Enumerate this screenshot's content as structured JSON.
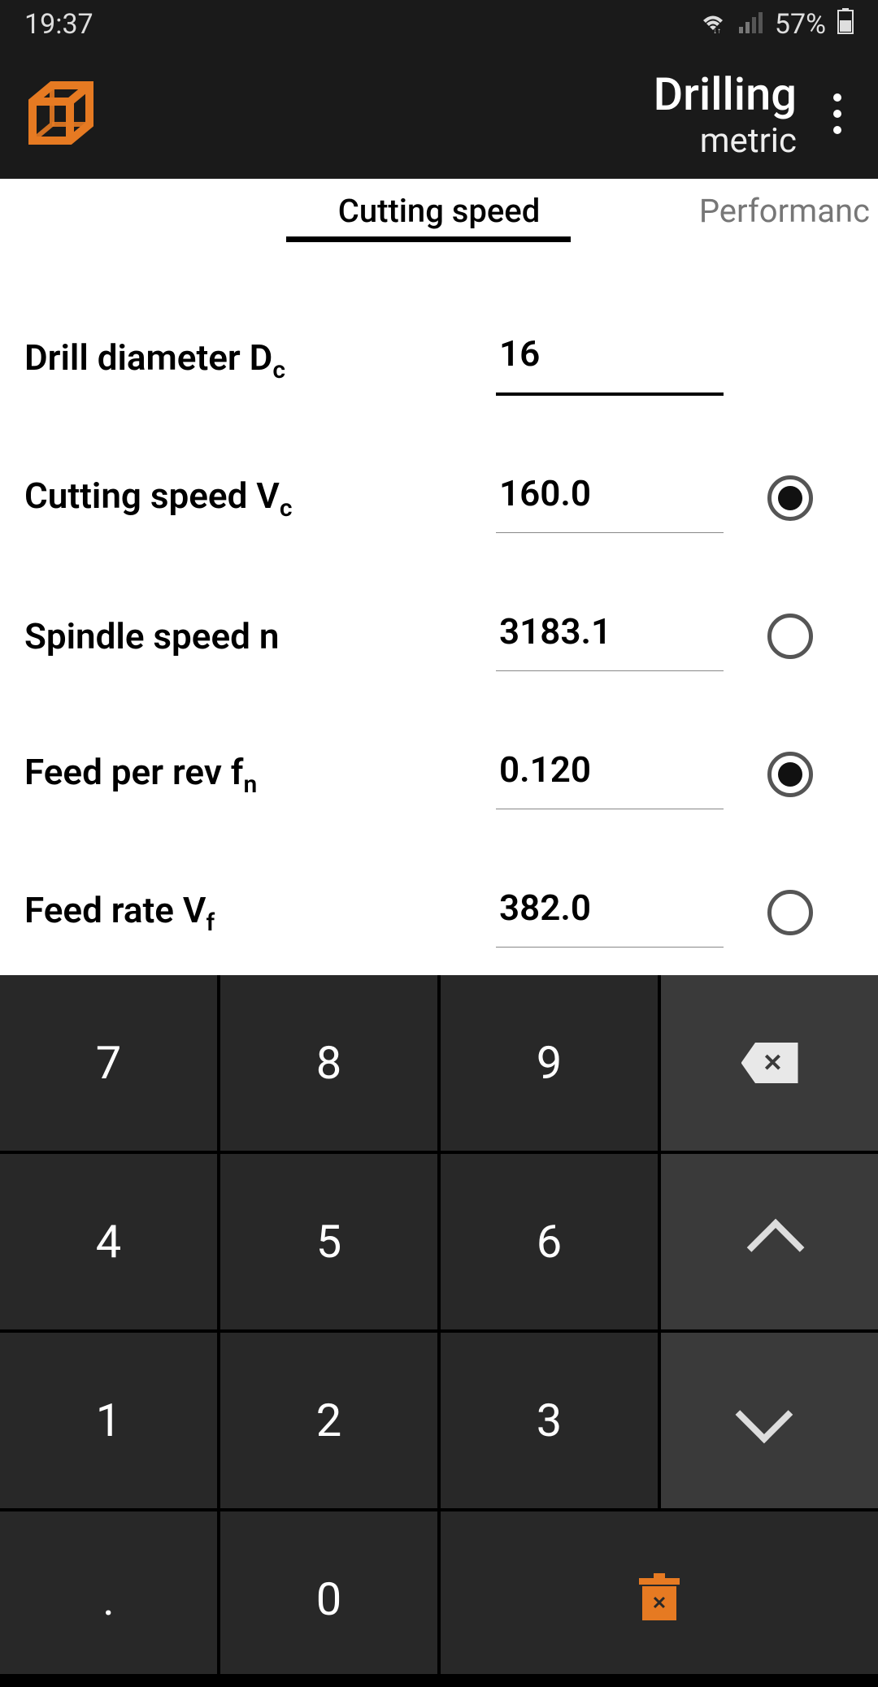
{
  "status": {
    "time": "19:37",
    "battery": "57%"
  },
  "header": {
    "title": "Drilling",
    "subtitle": "metric"
  },
  "tabs": {
    "active": "Cutting speed",
    "next": "Performanc"
  },
  "fields": [
    {
      "label": "Drill diameter D",
      "sub": "c",
      "value": "16",
      "hasRadio": false,
      "focused": true
    },
    {
      "label": "Cutting speed V",
      "sub": "c",
      "value": "160.0",
      "hasRadio": true,
      "checked": true
    },
    {
      "label": "Spindle speed n",
      "sub": "",
      "value": "3183.1",
      "hasRadio": true,
      "checked": false
    },
    {
      "label": "Feed per rev f",
      "sub": "n",
      "value": "0.120",
      "hasRadio": true,
      "checked": true
    },
    {
      "label": "Feed rate V",
      "sub": "f",
      "value": "382.0",
      "hasRadio": true,
      "checked": false
    }
  ],
  "keypad": {
    "k7": "7",
    "k8": "8",
    "k9": "9",
    "k4": "4",
    "k5": "5",
    "k6": "6",
    "k1": "1",
    "k2": "2",
    "k3": "3",
    "kdot": ".",
    "k0": "0"
  }
}
